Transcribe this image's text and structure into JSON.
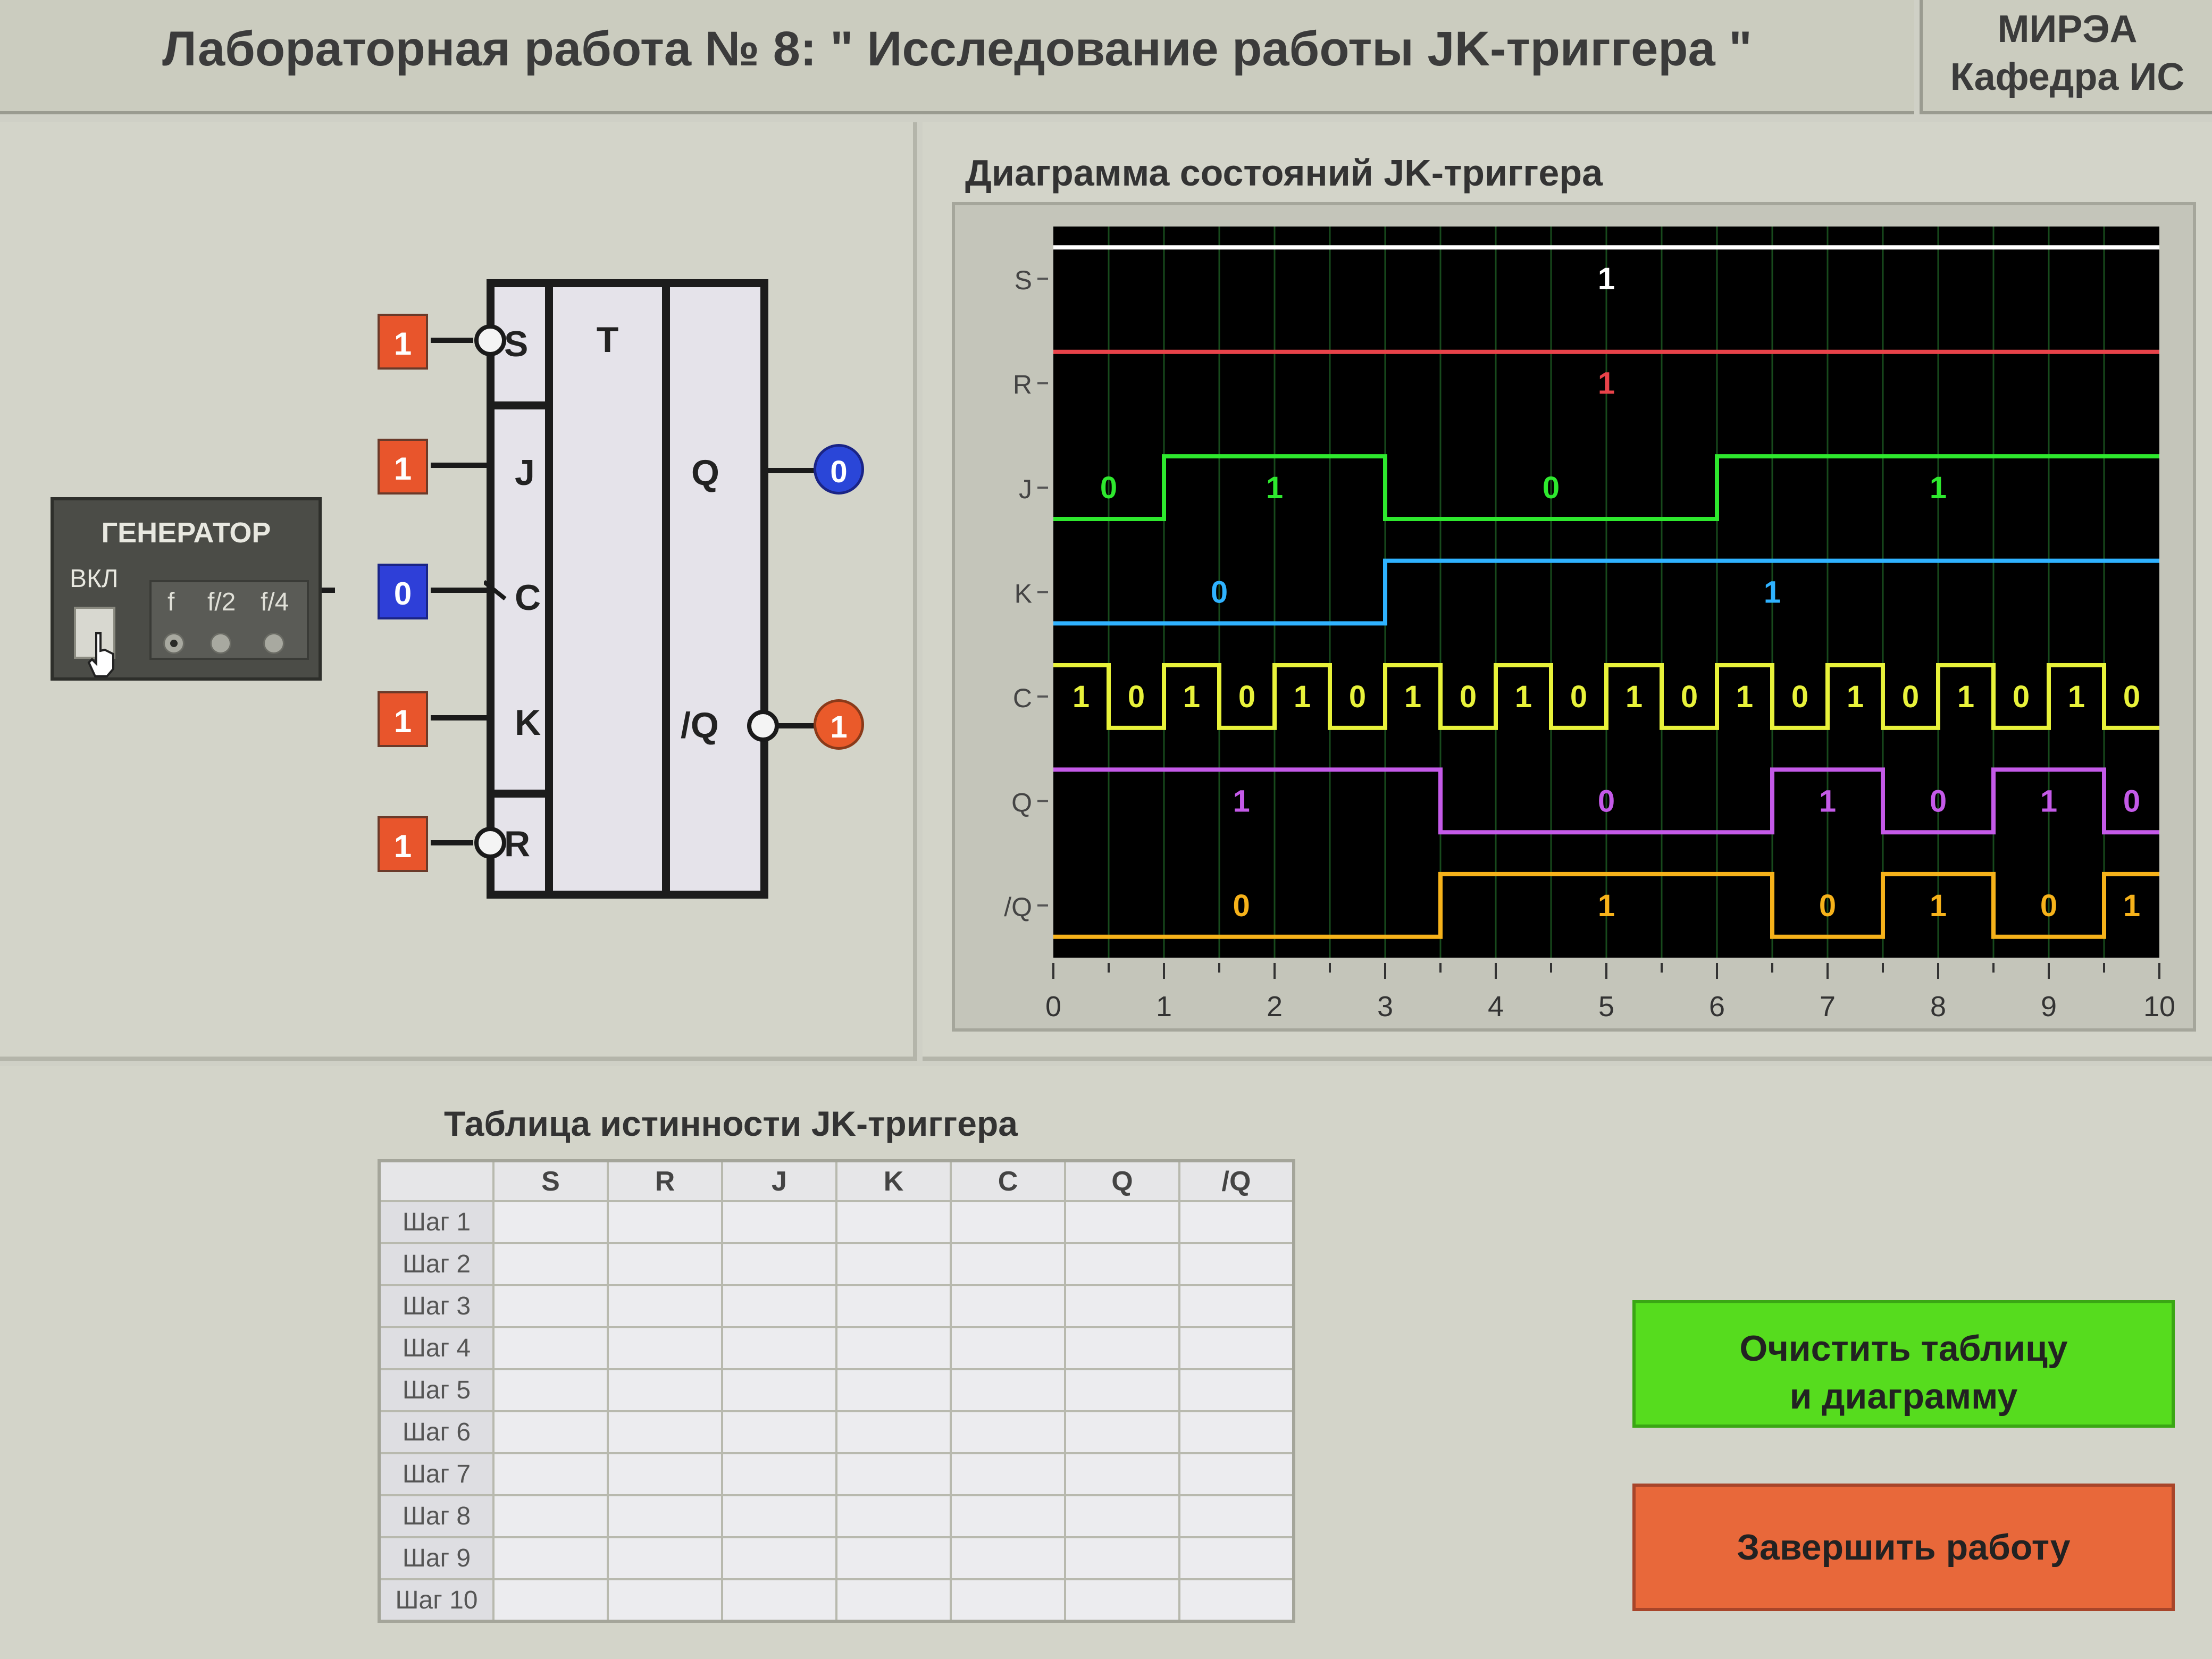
{
  "header": {
    "title": "Лабораторная работа № 8: \" Исследование работы JK-триггера \""
  },
  "org": {
    "line1": "МИРЭА",
    "line2": "Кафедра ИС"
  },
  "generator": {
    "title": "ГЕНЕРАТОР",
    "on_label": "ВКЛ",
    "freq_labels": [
      "f",
      "f/2",
      "f/4"
    ],
    "selected": "f"
  },
  "inputs": {
    "S": "1",
    "J": "1",
    "C": "0",
    "K": "1",
    "R": "1"
  },
  "trigger": {
    "labels": {
      "S": "S",
      "J": "J",
      "C": "C",
      "K": "K",
      "R": "R",
      "T": "T",
      "Q": "Q",
      "nQ": "/Q"
    }
  },
  "outputs": {
    "Q": "0",
    "nQ": "1"
  },
  "colors": {
    "S": "#ffffff",
    "R": "#e8434a",
    "J": "#2ee82e",
    "K": "#2fb2ff",
    "C": "#e8f23a",
    "Q": "#c45ae8",
    "nQ": "#f6b21a"
  },
  "chart_title": "Диаграмма состояний JK-триггера",
  "chart_data": {
    "type": "line",
    "title": "Диаграмма состояний JK-триггера",
    "x_ticks": [
      "0",
      "1",
      "2",
      "3",
      "4",
      "5",
      "6",
      "7",
      "8",
      "9",
      "10"
    ],
    "xlim": [
      0,
      10
    ],
    "signals": [
      {
        "name": "S",
        "steps": [
          [
            0,
            1
          ]
        ],
        "labels": [
          {
            "x": 5,
            "text": "1"
          }
        ]
      },
      {
        "name": "R",
        "steps": [
          [
            0,
            1
          ]
        ],
        "labels": [
          {
            "x": 5,
            "text": "1"
          }
        ]
      },
      {
        "name": "J",
        "steps": [
          [
            0,
            0
          ],
          [
            1,
            1
          ],
          [
            3,
            0
          ],
          [
            6,
            1
          ]
        ],
        "labels": [
          {
            "x": 0.5,
            "text": "0"
          },
          {
            "x": 2,
            "text": "1"
          },
          {
            "x": 4.5,
            "text": "0"
          },
          {
            "x": 8,
            "text": "1"
          }
        ]
      },
      {
        "name": "K",
        "steps": [
          [
            0,
            0
          ],
          [
            3,
            1
          ]
        ],
        "labels": [
          {
            "x": 1.5,
            "text": "0"
          },
          {
            "x": 6.5,
            "text": "1"
          }
        ]
      },
      {
        "name": "C",
        "steps": [
          [
            0,
            1
          ],
          [
            0.5,
            0
          ],
          [
            1,
            1
          ],
          [
            1.5,
            0
          ],
          [
            2,
            1
          ],
          [
            2.5,
            0
          ],
          [
            3,
            1
          ],
          [
            3.5,
            0
          ],
          [
            4,
            1
          ],
          [
            4.5,
            0
          ],
          [
            5,
            1
          ],
          [
            5.5,
            0
          ],
          [
            6,
            1
          ],
          [
            6.5,
            0
          ],
          [
            7,
            1
          ],
          [
            7.5,
            0
          ],
          [
            8,
            1
          ],
          [
            8.5,
            0
          ],
          [
            9,
            1
          ],
          [
            9.5,
            0
          ]
        ],
        "labels": [
          {
            "x": 0.25,
            "text": "1"
          },
          {
            "x": 0.75,
            "text": "0"
          },
          {
            "x": 1.25,
            "text": "1"
          },
          {
            "x": 1.75,
            "text": "0"
          },
          {
            "x": 2.25,
            "text": "1"
          },
          {
            "x": 2.75,
            "text": "0"
          },
          {
            "x": 3.25,
            "text": "1"
          },
          {
            "x": 3.75,
            "text": "0"
          },
          {
            "x": 4.25,
            "text": "1"
          },
          {
            "x": 4.75,
            "text": "0"
          },
          {
            "x": 5.25,
            "text": "1"
          },
          {
            "x": 5.75,
            "text": "0"
          },
          {
            "x": 6.25,
            "text": "1"
          },
          {
            "x": 6.75,
            "text": "0"
          },
          {
            "x": 7.25,
            "text": "1"
          },
          {
            "x": 7.75,
            "text": "0"
          },
          {
            "x": 8.25,
            "text": "1"
          },
          {
            "x": 8.75,
            "text": "0"
          },
          {
            "x": 9.25,
            "text": "1"
          },
          {
            "x": 9.75,
            "text": "0"
          }
        ]
      },
      {
        "name": "Q",
        "steps": [
          [
            0,
            1
          ],
          [
            3.5,
            0
          ],
          [
            6.5,
            1
          ],
          [
            7.5,
            0
          ],
          [
            8.5,
            1
          ],
          [
            9.5,
            0
          ]
        ],
        "labels": [
          {
            "x": 1.7,
            "text": "1"
          },
          {
            "x": 5,
            "text": "0"
          },
          {
            "x": 7,
            "text": "1"
          },
          {
            "x": 8,
            "text": "0"
          },
          {
            "x": 9,
            "text": "1"
          },
          {
            "x": 9.75,
            "text": "0"
          }
        ]
      },
      {
        "name": "/Q",
        "steps": [
          [
            0,
            0
          ],
          [
            3.5,
            1
          ],
          [
            6.5,
            0
          ],
          [
            7.5,
            1
          ],
          [
            8.5,
            0
          ],
          [
            9.5,
            1
          ]
        ],
        "labels": [
          {
            "x": 1.7,
            "text": "0"
          },
          {
            "x": 5,
            "text": "1"
          },
          {
            "x": 7,
            "text": "0"
          },
          {
            "x": 8,
            "text": "1"
          },
          {
            "x": 9,
            "text": "0"
          },
          {
            "x": 9.75,
            "text": "1"
          }
        ]
      }
    ]
  },
  "table": {
    "title": "Таблица истинности JK-триггера",
    "columns": [
      "S",
      "R",
      "J",
      "K",
      "C",
      "Q",
      "/Q"
    ],
    "rows": [
      "Шаг 1",
      "Шаг 2",
      "Шаг 3",
      "Шаг 4",
      "Шаг 5",
      "Шаг 6",
      "Шаг 7",
      "Шаг 8",
      "Шаг 9",
      "Шаг 10"
    ]
  },
  "buttons": {
    "clear_line1": "Очистить таблицу",
    "clear_line2": "и диаграмму",
    "finish": "Завершить работу"
  }
}
